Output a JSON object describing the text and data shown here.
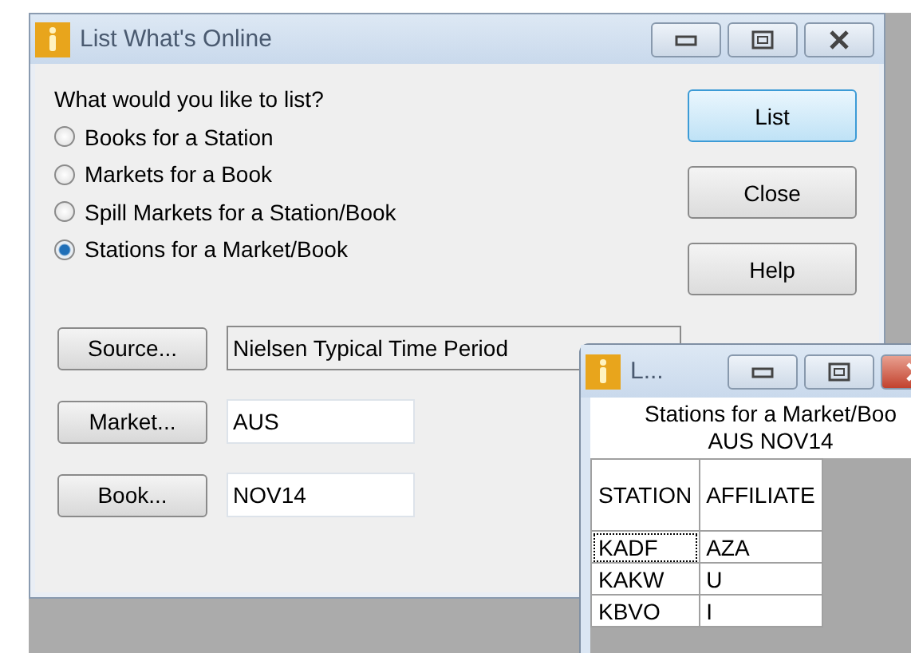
{
  "window": {
    "title": "List What's Online"
  },
  "prompt": "What would you like to list?",
  "options": [
    {
      "label": "Books for a Station",
      "selected": false
    },
    {
      "label": "Markets for a Book",
      "selected": false
    },
    {
      "label": "Spill Markets for a Station/Book",
      "selected": false
    },
    {
      "label": "Stations for a Market/Book",
      "selected": true
    }
  ],
  "buttons": [
    {
      "label": "List",
      "default": true
    },
    {
      "label": "Close",
      "default": false
    },
    {
      "label": "Help",
      "default": false
    }
  ],
  "fields": [
    {
      "button": "Source...",
      "value": "Nielsen Typical Time Period",
      "disabled": true
    },
    {
      "button": "Market...",
      "value": "AUS",
      "disabled": false
    },
    {
      "button": "Book...",
      "value": "NOV14",
      "disabled": false
    }
  ],
  "result_window": {
    "title": "L...",
    "subtitle": "Stations for a Market/Boo",
    "subtitle_2": "AUS  NOV14",
    "table": {
      "columns": [
        "STATION",
        "AFFILIATE"
      ],
      "rows": [
        {
          "cells": [
            "KADF",
            "AZA"
          ],
          "focused": true
        },
        {
          "cells": [
            "KAKW",
            "U"
          ],
          "focused": false
        },
        {
          "cells": [
            "KBVO",
            "I"
          ],
          "focused": false
        }
      ]
    }
  }
}
